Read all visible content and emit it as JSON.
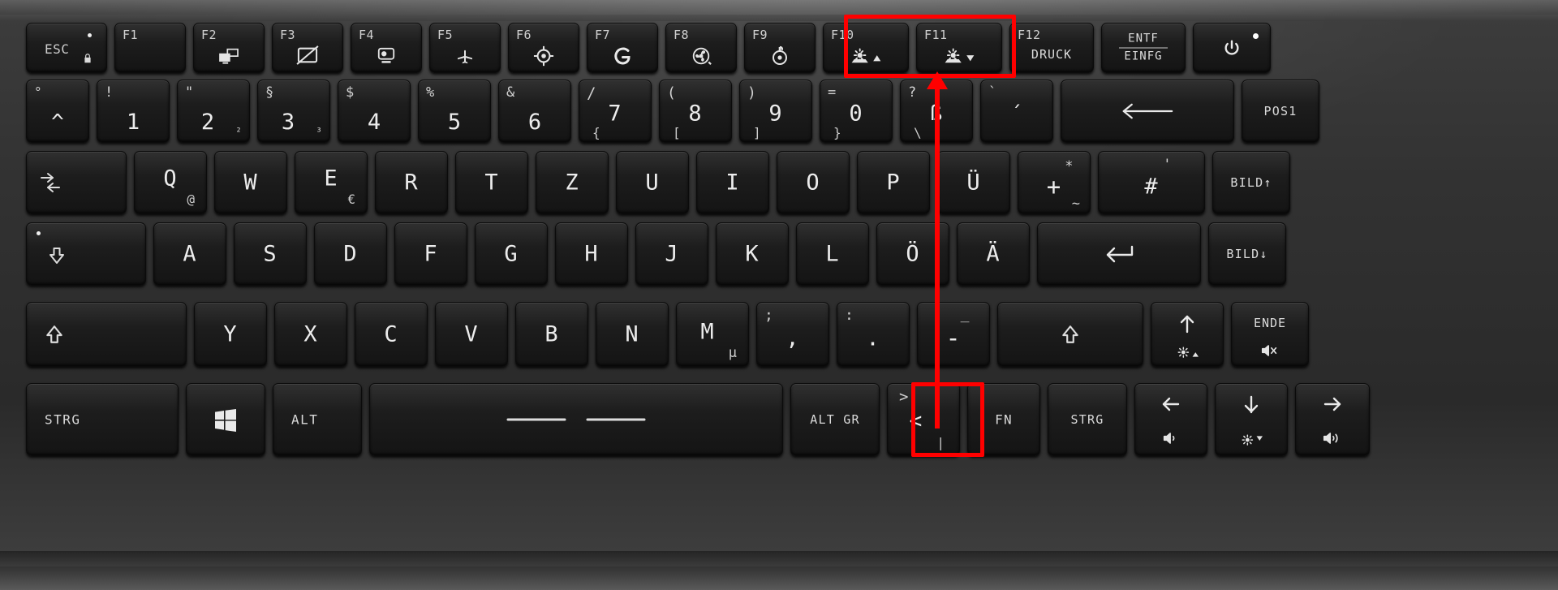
{
  "device": {
    "type": "laptop-keyboard",
    "layout": "German QWERTZ (DE)",
    "accent_color": "#ff0000",
    "key_color": "#1b1b1b",
    "legend_color": "#e9e9e9"
  },
  "annotation": {
    "highlight_1_label": "F10 / F11 keyboard backlight keys",
    "highlight_2_label": "FN key",
    "arrow_label": "press FN together with F10 / F11",
    "color": "#ff0000"
  },
  "rows": {
    "function_row": [
      {
        "name": "esc",
        "top": "ESC",
        "icon": "caps-lock-dot-and-padlock",
        "led": true
      },
      {
        "name": "f1",
        "top": "F1",
        "icon": ""
      },
      {
        "name": "f2",
        "top": "F2",
        "icon": "external-display-icon"
      },
      {
        "name": "f3",
        "top": "F3",
        "icon": "touchpad-off-icon"
      },
      {
        "name": "f4",
        "top": "F4",
        "icon": "webcam-icon"
      },
      {
        "name": "f5",
        "top": "F5",
        "icon": "airplane-mode-icon"
      },
      {
        "name": "f6",
        "top": "F6",
        "icon": "crosshair-icon"
      },
      {
        "name": "f7",
        "top": "F7",
        "icon": "g-logo-icon"
      },
      {
        "name": "f8",
        "top": "F8",
        "icon": "cooler-boost-fan-icon"
      },
      {
        "name": "f9",
        "top": "F9",
        "icon": "steelseries-logo-icon"
      },
      {
        "name": "f10",
        "top": "F10",
        "icon": "keyboard-backlight-up-icon",
        "highlighted": true
      },
      {
        "name": "f11",
        "top": "F11",
        "icon": "keyboard-backlight-down-icon",
        "highlighted": true
      },
      {
        "name": "f12",
        "top": "F12",
        "sub": "DRUCK"
      },
      {
        "name": "entf-einfg",
        "line1": "ENTF",
        "line2": "EINFG"
      },
      {
        "name": "power",
        "icon": "power-icon",
        "led": true
      }
    ],
    "number_row": [
      {
        "name": "circumflex",
        "shift": "°",
        "main": "^"
      },
      {
        "name": "1",
        "shift": "!",
        "main": "1"
      },
      {
        "name": "2",
        "shift": "\"",
        "main": "2",
        "altgr": "²"
      },
      {
        "name": "3",
        "shift": "§",
        "main": "3",
        "altgr": "³"
      },
      {
        "name": "4",
        "shift": "$",
        "main": "4"
      },
      {
        "name": "5",
        "shift": "%",
        "main": "5"
      },
      {
        "name": "6",
        "shift": "&",
        "main": "6"
      },
      {
        "name": "7",
        "shift": "/",
        "main": "7",
        "altgr": "{"
      },
      {
        "name": "8",
        "shift": "(",
        "main": "8",
        "altgr": "["
      },
      {
        "name": "9",
        "shift": ")",
        "main": "9",
        "altgr": "]"
      },
      {
        "name": "0",
        "shift": "=",
        "main": "0",
        "altgr": "}"
      },
      {
        "name": "sz",
        "shift": "?",
        "main": "ß",
        "altgr": "\\"
      },
      {
        "name": "acute",
        "shift": "`",
        "main": "´"
      },
      {
        "name": "backspace",
        "icon": "backspace-arrow-icon"
      },
      {
        "name": "pos1",
        "main": "POS1"
      }
    ],
    "top_letter_row": [
      {
        "name": "tab",
        "icon": "tab-icon"
      },
      {
        "name": "q",
        "main": "Q",
        "altgr": "@"
      },
      {
        "name": "w",
        "main": "W"
      },
      {
        "name": "e",
        "main": "E",
        "altgr": "€"
      },
      {
        "name": "r",
        "main": "R"
      },
      {
        "name": "t",
        "main": "T"
      },
      {
        "name": "z",
        "main": "Z"
      },
      {
        "name": "u",
        "main": "U"
      },
      {
        "name": "i",
        "main": "I"
      },
      {
        "name": "o",
        "main": "O"
      },
      {
        "name": "p",
        "main": "P"
      },
      {
        "name": "uuml",
        "main": "Ü"
      },
      {
        "name": "plus",
        "shift": "*",
        "main": "+",
        "altgr": "~"
      },
      {
        "name": "hash",
        "shift": "'",
        "main": "#"
      },
      {
        "name": "bild-up",
        "main": "BILD↑"
      }
    ],
    "home_row": [
      {
        "name": "caps-lock",
        "icon": "caps-lock-icon",
        "led": true
      },
      {
        "name": "a",
        "main": "A"
      },
      {
        "name": "s",
        "main": "S"
      },
      {
        "name": "d",
        "main": "D"
      },
      {
        "name": "f",
        "main": "F"
      },
      {
        "name": "g",
        "main": "G"
      },
      {
        "name": "h",
        "main": "H"
      },
      {
        "name": "j",
        "main": "J"
      },
      {
        "name": "k",
        "main": "K"
      },
      {
        "name": "l",
        "main": "L"
      },
      {
        "name": "ouml",
        "main": "Ö"
      },
      {
        "name": "auml",
        "main": "Ä"
      },
      {
        "name": "enter",
        "icon": "enter-arrow-icon"
      },
      {
        "name": "bild-down",
        "main": "BILD↓"
      }
    ],
    "shift_row": [
      {
        "name": "shift-left",
        "icon": "shift-arrow-icon"
      },
      {
        "name": "y",
        "main": "Y"
      },
      {
        "name": "x",
        "main": "X"
      },
      {
        "name": "c",
        "main": "C"
      },
      {
        "name": "v",
        "main": "V"
      },
      {
        "name": "b",
        "main": "B"
      },
      {
        "name": "n",
        "main": "N"
      },
      {
        "name": "m",
        "main": "M",
        "altgr": "µ"
      },
      {
        "name": "comma",
        "shift": ";",
        "main": ","
      },
      {
        "name": "period",
        "shift": ":",
        "main": "."
      },
      {
        "name": "minus",
        "shift": "_",
        "main": "-"
      },
      {
        "name": "shift-right",
        "icon": "shift-arrow-icon"
      },
      {
        "name": "arrow-up",
        "icon": "arrow-up-icon",
        "fn": "display-brightness-up-icon"
      },
      {
        "name": "ende",
        "main": "ENDE",
        "fn": "mute-icon"
      }
    ],
    "bottom_row": [
      {
        "name": "strg-left",
        "main": "STRG"
      },
      {
        "name": "windows",
        "icon": "windows-logo-icon"
      },
      {
        "name": "alt",
        "main": "ALT"
      },
      {
        "name": "space",
        "icon": "space-bar-marks"
      },
      {
        "name": "alt-gr",
        "main": "ALT GR"
      },
      {
        "name": "less-greater",
        "shift": ">",
        "main": "<",
        "altgr": "|"
      },
      {
        "name": "fn",
        "main": "FN",
        "highlighted": true
      },
      {
        "name": "strg-right",
        "main": "STRG"
      },
      {
        "name": "arrow-left",
        "icon": "arrow-left-icon",
        "fn": "volume-down-icon"
      },
      {
        "name": "arrow-down",
        "icon": "arrow-down-icon",
        "fn": "display-brightness-down-icon"
      },
      {
        "name": "arrow-right",
        "icon": "arrow-right-icon",
        "fn": "volume-up-icon"
      }
    ]
  }
}
